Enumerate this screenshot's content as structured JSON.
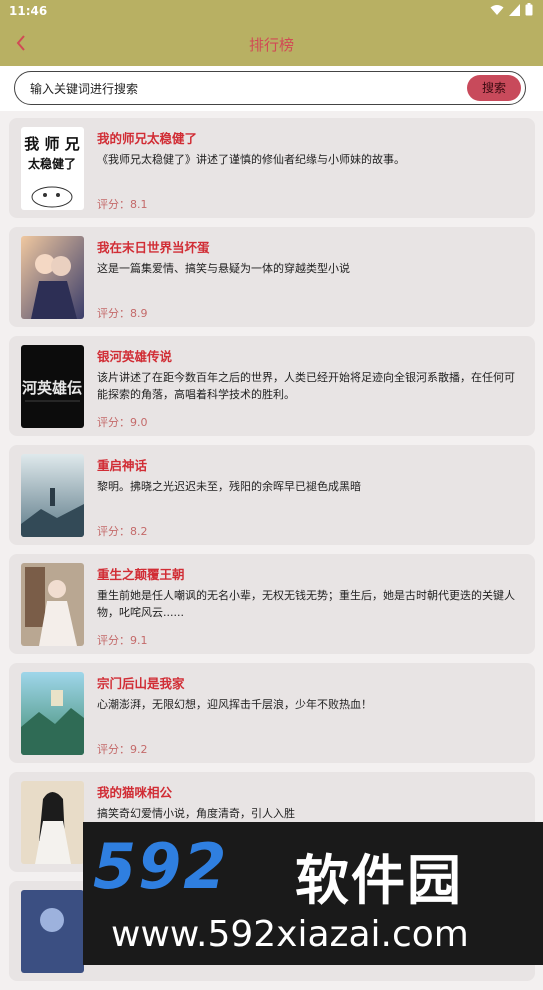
{
  "status_bar": {
    "time": "11:46"
  },
  "header": {
    "title": "排行榜"
  },
  "search": {
    "placeholder": "输入关键词进行搜索",
    "button_label": "搜索"
  },
  "books": [
    {
      "title": "我的师兄太稳健了",
      "desc": "《我师兄太稳健了》讲述了谨慎的修仙者纪缘与小师妹的故事。",
      "score": "评分：8.1",
      "cover_text": [
        "我 师 兄",
        "太稳健了"
      ]
    },
    {
      "title": "我在末日世界当坏蛋",
      "desc": "这是一篇集爱情、搞笑与悬疑为一体的穿越类型小说",
      "score": "评分：8.9"
    },
    {
      "title": "银河英雄传说",
      "desc": "该片讲述了在距今数百年之后的世界，人类已经开始将足迹向全银河系散播，在任何可能探索的角落，高唱着科学技术的胜利。",
      "score": "评分：9.0",
      "cover_text": [
        "河英雄伝"
      ]
    },
    {
      "title": "重启神话",
      "desc": "黎明。拂晓之光迟迟未至，残阳的余晖早已褪色成黑暗",
      "score": "评分：8.2"
    },
    {
      "title": "重生之颠覆王朝",
      "desc": "重生前她是任人嘲讽的无名小辈，无权无钱无势；重生后，她是古时朝代更迭的关键人物，叱咤风云......",
      "score": "评分：9.1"
    },
    {
      "title": "宗门后山是我家",
      "desc": "心潮澎湃，无限幻想，迎风挥击千层浪，少年不败热血！",
      "score": "评分：9.2"
    },
    {
      "title": "我的猫咪相公",
      "desc": "搞笑奇幻爱情小说，角度清奇，引人入胜",
      "score": ""
    },
    {
      "title": "",
      "desc": "",
      "score": ""
    }
  ],
  "watermark": {
    "logo": "592",
    "name": "软件园",
    "url": "www.592xiazai.com"
  },
  "colors": {
    "header_bg": "#b8b063",
    "title_red": "#d12d35",
    "button": "#c84a5b",
    "card_bg": "#e8e4e4"
  }
}
